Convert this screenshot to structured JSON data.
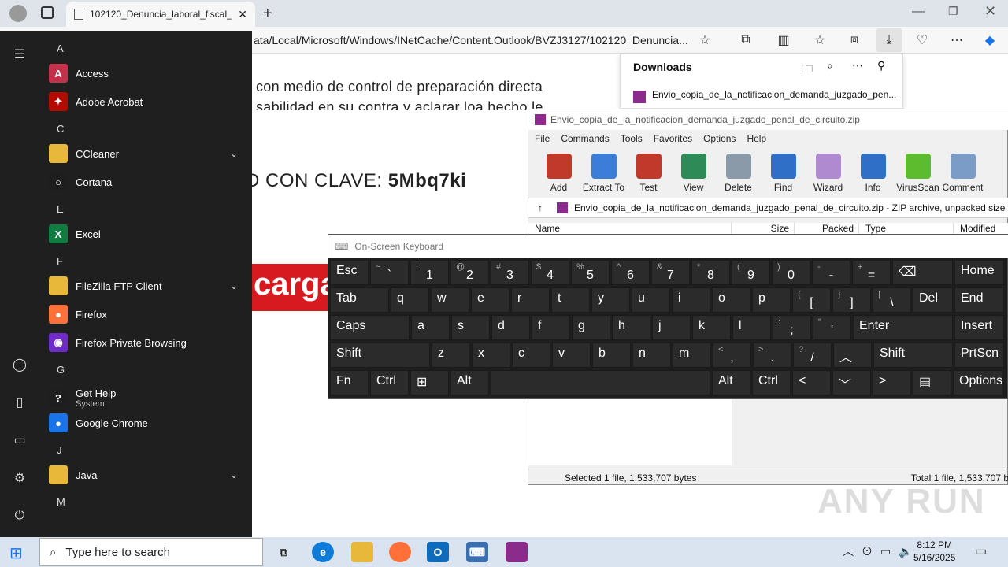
{
  "browser": {
    "tab_title": "102120_Denuncia_laboral_fiscal_",
    "url": "ata/Local/Microsoft/Windows/INetCache/Content.Outlook/BVZJ3127/102120_Denuncia...",
    "downloads": {
      "title": "Downloads",
      "item": "Envio_copia_de_la_notificacion_demanda_juzgado_pen..."
    }
  },
  "document": {
    "line1": "con medio de control de preparación directa",
    "line2": "sabilidad en su contra y aclarar loa hecho le",
    "clave_prefix": "D CON CLAVE: ",
    "clave_value": "5Mbq7ki",
    "button": "carga"
  },
  "start_menu": {
    "groups": [
      {
        "letter": "A",
        "apps": [
          {
            "label": "Access",
            "color": "#c4314b",
            "icon": "A"
          },
          {
            "label": "Adobe Acrobat",
            "color": "#b30b00",
            "icon": "✦"
          }
        ]
      },
      {
        "letter": "C",
        "apps": [
          {
            "label": "CCleaner",
            "color": "#e8b83a",
            "icon": ""
          },
          {
            "label": "Cortana",
            "color": "#1e1e1e",
            "icon": "○"
          }
        ]
      },
      {
        "letter": "E",
        "apps": [
          {
            "label": "Excel",
            "color": "#107c41",
            "icon": "X"
          }
        ]
      },
      {
        "letter": "F",
        "apps": [
          {
            "label": "FileZilla FTP Client",
            "color": "#e8b83a",
            "icon": ""
          },
          {
            "label": "Firefox",
            "color": "#ff7139",
            "icon": "●"
          },
          {
            "label": "Firefox Private Browsing",
            "color": "#6e2bc7",
            "icon": "◉"
          }
        ]
      },
      {
        "letter": "G",
        "apps": [
          {
            "label": "Get Help",
            "sub": "System",
            "color": "#1e1e1e",
            "icon": "?"
          },
          {
            "label": "Google Chrome",
            "color": "#1a73e8",
            "icon": "●"
          }
        ]
      },
      {
        "letter": "J",
        "apps": [
          {
            "label": "Java",
            "color": "#e8b83a",
            "icon": ""
          }
        ]
      },
      {
        "letter": "M",
        "apps": []
      }
    ]
  },
  "winrar": {
    "title": "Envio_copia_de_la_notificacion_demanda_juzgado_penal_de_circuito.zip",
    "menu": [
      "File",
      "Commands",
      "Tools",
      "Favorites",
      "Options",
      "Help"
    ],
    "tools": [
      {
        "label": "Add",
        "color": "#c0392b"
      },
      {
        "label": "Extract To",
        "color": "#3b7dd8"
      },
      {
        "label": "Test",
        "color": "#c0392b"
      },
      {
        "label": "View",
        "color": "#2e8b57"
      },
      {
        "label": "Delete",
        "color": "#8a9aa8"
      },
      {
        "label": "Find",
        "color": "#2f6fc8"
      },
      {
        "label": "Wizard",
        "color": "#b08ad0"
      },
      {
        "label": "Info",
        "color": "#2f6fc8"
      },
      {
        "label": "VirusScan",
        "color": "#5dbb2e"
      },
      {
        "label": "Comment",
        "color": "#7a9cc6"
      }
    ],
    "path": "Envio_copia_de_la_notificacion_demanda_juzgado_penal_de_circuito.zip - ZIP archive, unpacked size",
    "columns": [
      "Name",
      "Size",
      "Packed",
      "Type",
      "Modified"
    ],
    "status_left": "Selected 1 file, 1,533,707 bytes",
    "status_right": "Total 1 file, 1,533,707 b"
  },
  "osk": {
    "title": "On-Screen Keyboard",
    "rows": [
      [
        {
          "m": "Esc",
          "w": 50
        },
        {
          "s": "~",
          "b": "`",
          "w": 50
        },
        {
          "s": "!",
          "b": "1",
          "w": 50
        },
        {
          "s": "@",
          "b": "2",
          "w": 50
        },
        {
          "s": "#",
          "b": "3",
          "w": 50
        },
        {
          "s": "$",
          "b": "4",
          "w": 50
        },
        {
          "s": "%",
          "b": "5",
          "w": 50
        },
        {
          "s": "^",
          "b": "6",
          "w": 50
        },
        {
          "s": "&",
          "b": "7",
          "w": 50
        },
        {
          "s": "*",
          "b": "8",
          "w": 50
        },
        {
          "s": "(",
          "b": "9",
          "w": 50
        },
        {
          "s": ")",
          "b": "0",
          "w": 50
        },
        {
          "s": "-",
          "b": "-",
          "w": 50
        },
        {
          "s": "+",
          "b": "=",
          "w": 50
        },
        {
          "m": "⌫",
          "w": 78
        },
        {
          "m": "Home",
          "w": 64
        }
      ],
      [
        {
          "m": "Tab",
          "w": 76
        },
        {
          "m": "q",
          "w": 50
        },
        {
          "m": "w",
          "w": 50
        },
        {
          "m": "e",
          "w": 50
        },
        {
          "m": "r",
          "w": 50
        },
        {
          "m": "t",
          "w": 50
        },
        {
          "m": "y",
          "w": 50
        },
        {
          "m": "u",
          "w": 50
        },
        {
          "m": "i",
          "w": 50
        },
        {
          "m": "o",
          "w": 50
        },
        {
          "m": "p",
          "w": 50
        },
        {
          "s": "{",
          "b": "[",
          "w": 50
        },
        {
          "s": "}",
          "b": "]",
          "w": 50
        },
        {
          "s": "|",
          "b": "\\",
          "w": 50
        },
        {
          "m": "Del",
          "w": 52
        },
        {
          "m": "End",
          "w": 64
        }
      ],
      [
        {
          "m": "Caps",
          "w": 102
        },
        {
          "m": "a",
          "w": 50
        },
        {
          "m": "s",
          "w": 50
        },
        {
          "m": "d",
          "w": 50
        },
        {
          "m": "f",
          "w": 50
        },
        {
          "m": "g",
          "w": 50
        },
        {
          "m": "h",
          "w": 50
        },
        {
          "m": "j",
          "w": 50
        },
        {
          "m": "k",
          "w": 50
        },
        {
          "m": "l",
          "w": 50
        },
        {
          "s": ":",
          "b": ";",
          "w": 50
        },
        {
          "s": "\"",
          "b": "'",
          "w": 50
        },
        {
          "m": "Enter",
          "w": 128
        },
        {
          "m": "Insert",
          "w": 64
        }
      ],
      [
        {
          "m": "Shift",
          "w": 128
        },
        {
          "m": "z",
          "w": 50
        },
        {
          "m": "x",
          "w": 50
        },
        {
          "m": "c",
          "w": 50
        },
        {
          "m": "v",
          "w": 50
        },
        {
          "m": "b",
          "w": 50
        },
        {
          "m": "n",
          "w": 50
        },
        {
          "m": "m",
          "w": 50
        },
        {
          "s": "<",
          "b": ",",
          "w": 50
        },
        {
          "s": ">",
          "b": ".",
          "w": 50
        },
        {
          "s": "?",
          "b": "/",
          "w": 50
        },
        {
          "m": "︿",
          "w": 50
        },
        {
          "m": "Shift",
          "w": 102
        },
        {
          "m": "PrtScn",
          "w": 64
        }
      ],
      [
        {
          "m": "Fn",
          "w": 50
        },
        {
          "m": "Ctrl",
          "w": 50
        },
        {
          "m": "⊞",
          "w": 50
        },
        {
          "m": "Alt",
          "w": 50
        },
        {
          "m": "",
          "w": 280
        },
        {
          "m": "Alt",
          "w": 50
        },
        {
          "m": "Ctrl",
          "w": 50
        },
        {
          "m": "<",
          "w": 50
        },
        {
          "m": "﹀",
          "w": 50
        },
        {
          "m": ">",
          "w": 50
        },
        {
          "m": "▤",
          "w": 50
        },
        {
          "m": "Options",
          "w": 64
        }
      ]
    ]
  },
  "taskbar": {
    "search_placeholder": "Type here to search",
    "time": "8:12 PM",
    "date": "5/16/2025"
  },
  "watermark": "ANY RUN"
}
